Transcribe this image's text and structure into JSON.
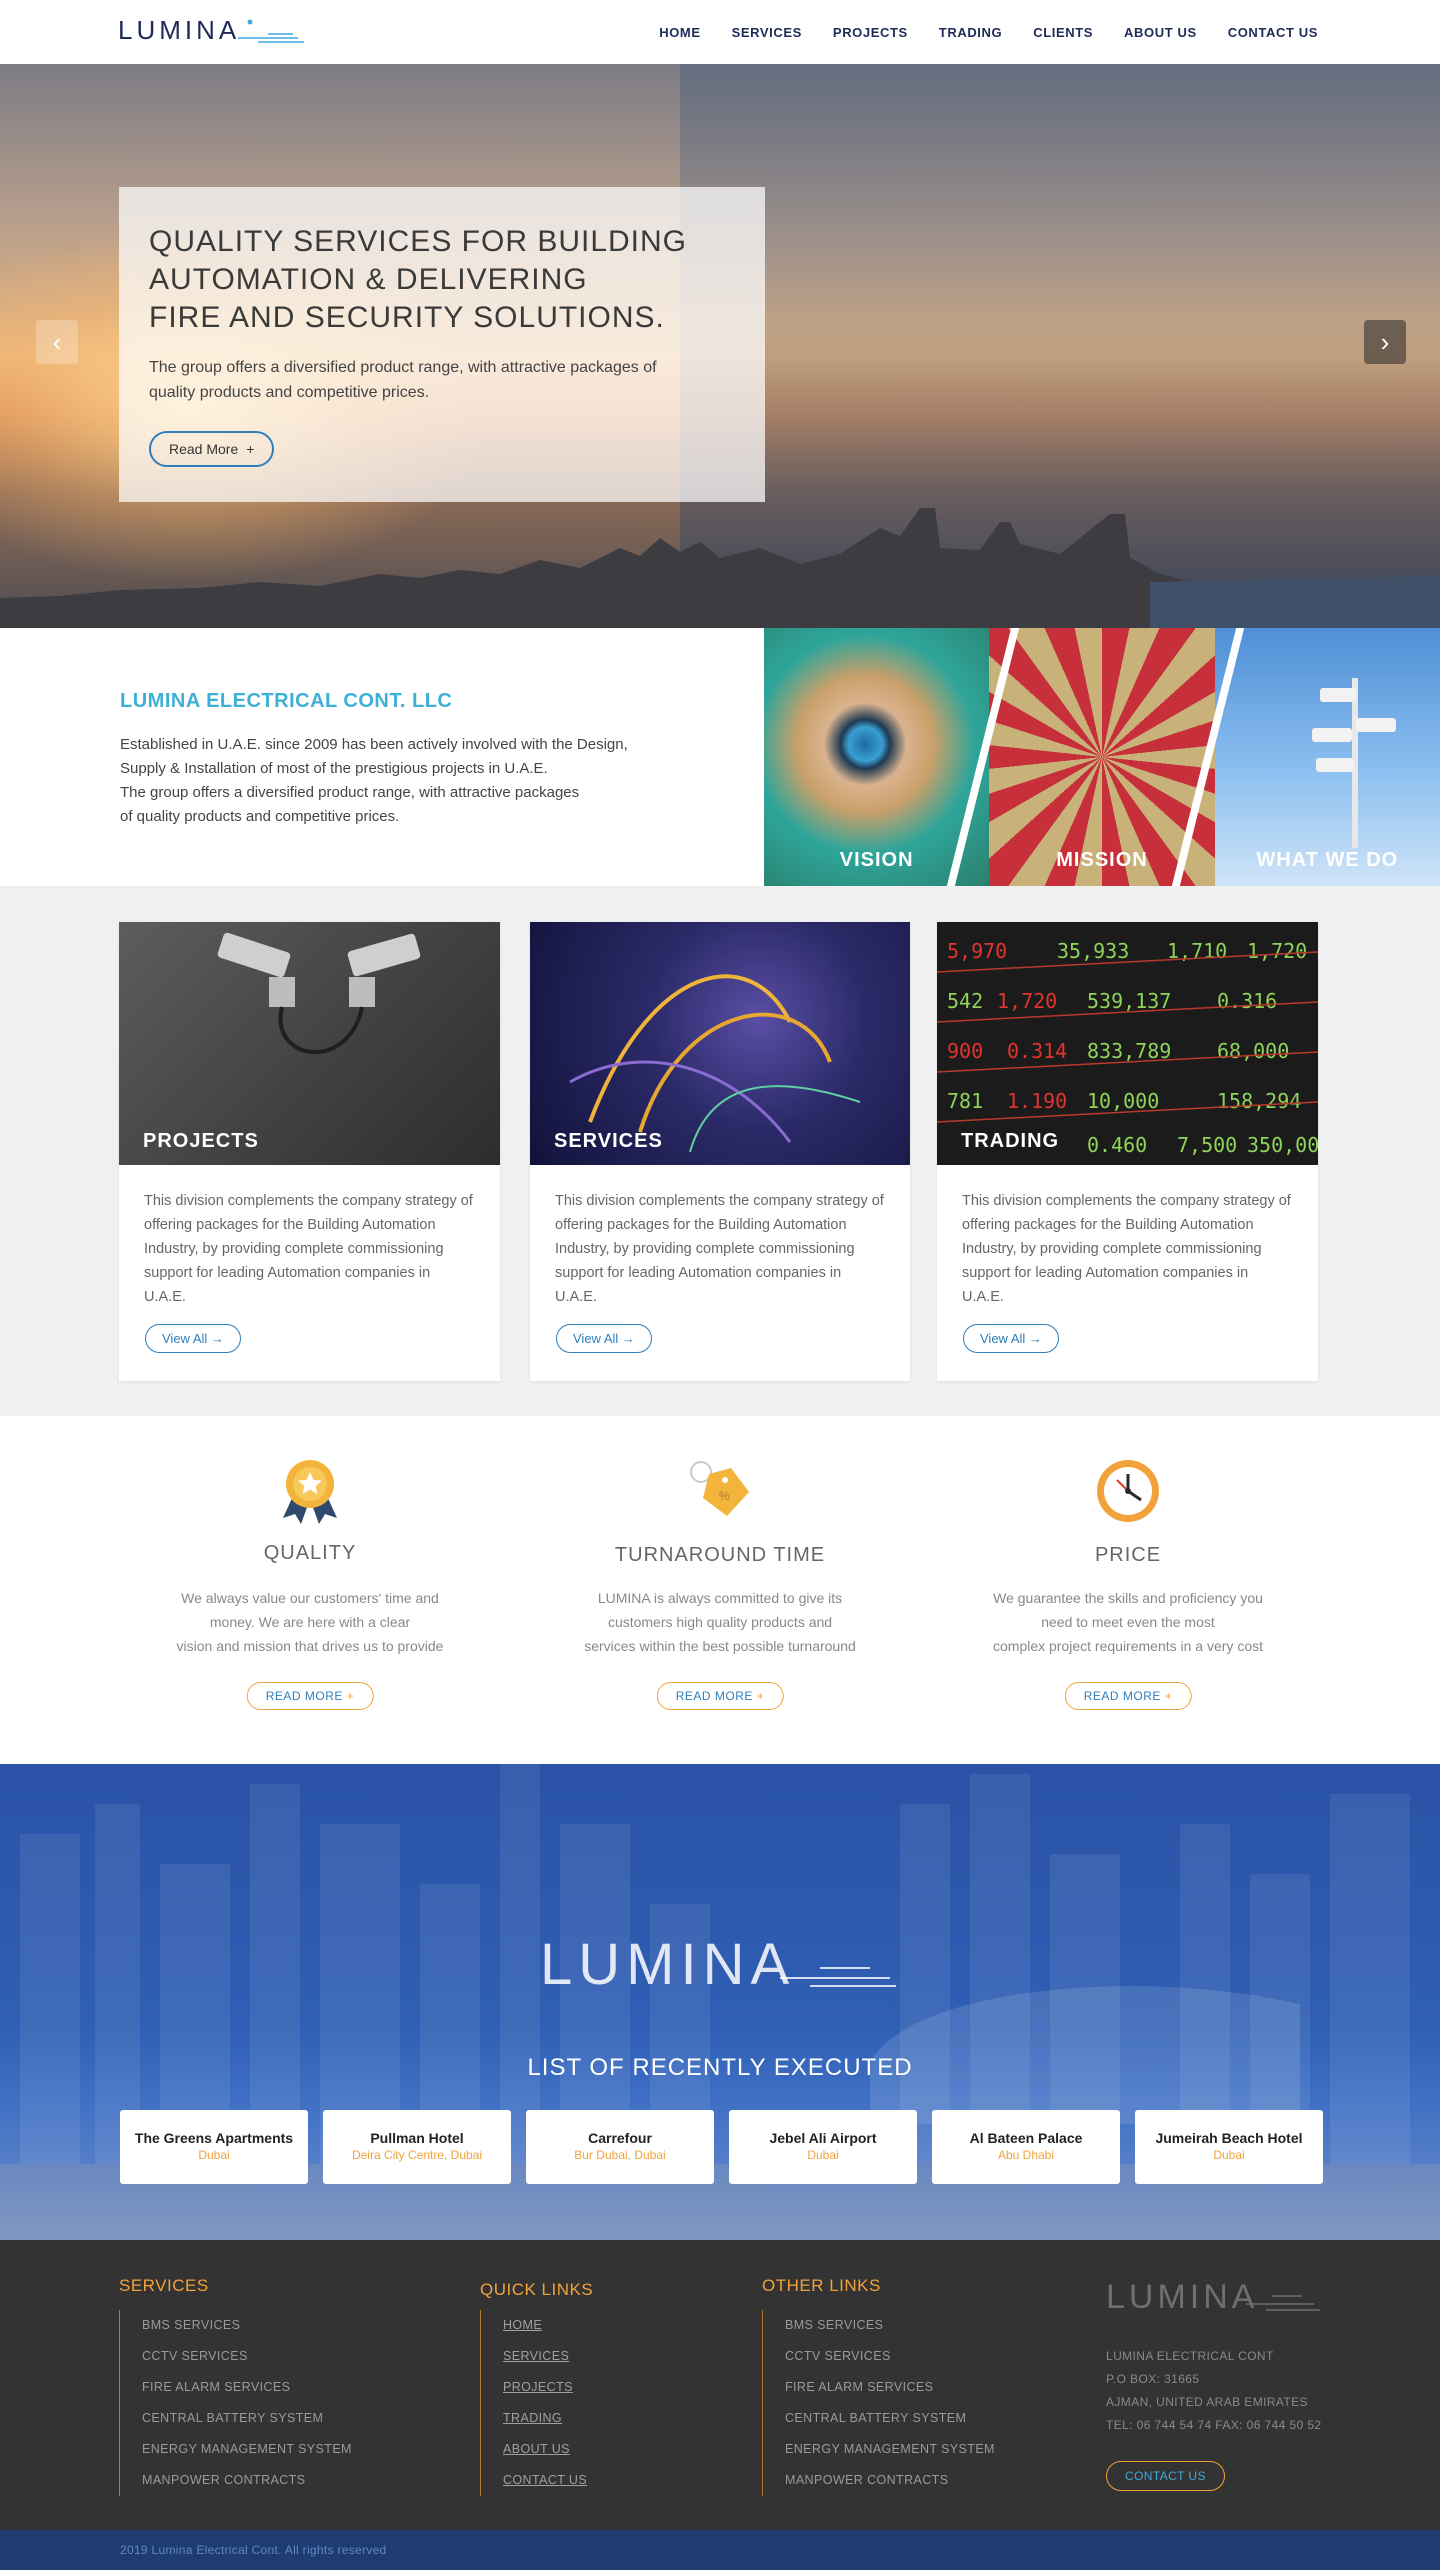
{
  "header": {
    "logo_text": "LUMINA",
    "nav": [
      "HOME",
      "SERVICES",
      "PROJECTS",
      "TRADING",
      "CLIENTS",
      "ABOUT US",
      "CONTACT US"
    ]
  },
  "hero": {
    "title_lines": [
      "QUALITY SERVICES FOR BUILDING",
      "AUTOMATION & DELIVERING",
      "FIRE AND SECURITY SOLUTIONS."
    ],
    "text": "The group offers a diversified product range, with attractive packages of quality products and competitive prices.",
    "button": "Read More",
    "button_icon": "+",
    "prev_icon": "‹",
    "next_icon": "›"
  },
  "about": {
    "title": "LUMINA ELECTRICAL CONT. LLC",
    "lines": [
      "Established in U.A.E. since 2009 has been actively involved with the Design,",
      "Supply & Installation of most of the prestigious projects in U.A.E.",
      "The group offers a diversified product range, with attractive packages",
      "of quality products and competitive prices."
    ],
    "panels": [
      "VISION",
      "MISSION",
      "WHAT WE DO"
    ]
  },
  "divisions": [
    {
      "label": "PROJECTS",
      "text": "This division complements the company strategy of offering packages for the Building Automation Industry, by providing complete commissioning support for leading Automation companies in U.A.E.",
      "button": "View All"
    },
    {
      "label": "SERVICES",
      "text": "This division complements the company strategy of offering packages for the Building Automation Industry, by providing complete commissioning support for leading Automation companies in U.A.E.",
      "button": "View All"
    },
    {
      "label": "TRADING",
      "text": "This division complements the company strategy of offering packages for the Building Automation Industry, by providing complete commissioning support for leading Automation companies in U.A.E.",
      "button": "View All"
    }
  ],
  "features": [
    {
      "title": "QUALITY",
      "lines": [
        "We always value our customers' time and",
        "money. We are here with a clear",
        "vision and mission that drives us to provide"
      ],
      "button": "READ MORE",
      "icon": "medal-icon"
    },
    {
      "title": "TURNAROUND TIME",
      "lines": [
        "LUMINA is always committed to give its",
        "customers high quality products and",
        "services within the best possible turnaround"
      ],
      "button": "READ MORE",
      "icon": "price-tag-icon"
    },
    {
      "title": "PRICE",
      "lines": [
        "We guarantee the skills and proficiency you",
        "need to meet even the most",
        "complex project requirements in a very cost"
      ],
      "button": "READ MORE",
      "icon": "clock-icon"
    }
  ],
  "projects": {
    "title": "LIST OF RECENTLY EXECUTED",
    "logo_text": "LUMINA",
    "clients": [
      {
        "name": "The Greens Apartments",
        "location": "Dubai"
      },
      {
        "name": "Pullman Hotel",
        "location": "Deira City Centre, Dubai"
      },
      {
        "name": "Carrefour",
        "location": "Bur Dubai, Dubai"
      },
      {
        "name": "Jebel Ali Airport",
        "location": "Dubai"
      },
      {
        "name": "Al Bateen Palace",
        "location": "Abu Dhabi"
      },
      {
        "name": "Jumeirah Beach Hotel",
        "location": "Dubai"
      }
    ]
  },
  "footer": {
    "services": {
      "title": "SERVICES",
      "items": [
        "BMS SERVICES",
        "CCTV SERVICES",
        "FIRE ALARM SERVICES",
        "CENTRAL BATTERY SYSTEM",
        "ENERGY MANAGEMENT SYSTEM",
        "MANPOWER CONTRACTS"
      ]
    },
    "quick_links": {
      "title": "QUICK LINKS",
      "items": [
        "HOME",
        "SERVICES",
        "PROJECTS",
        "TRADING",
        "ABOUT US",
        "CONTACT US"
      ]
    },
    "other_links": {
      "title": "OTHER LINKS",
      "items": [
        "BMS SERVICES",
        "CCTV SERVICES",
        "FIRE ALARM SERVICES",
        "CENTRAL BATTERY SYSTEM",
        "ENERGY MANAGEMENT SYSTEM",
        "MANPOWER CONTRACTS"
      ]
    },
    "contact": {
      "logo_text": "LUMINA",
      "lines": [
        "LUMINA ELECTRICAL CONT",
        "P.O BOX: 31665",
        "AJMAN, UNITED ARAB EMIRATES",
        "TEL: 06 744 54 74 FAX: 06 744 50 52"
      ],
      "button": "CONTACT US"
    },
    "copyright": "2019 Lumina Electrical Cont. All rights reserved"
  }
}
